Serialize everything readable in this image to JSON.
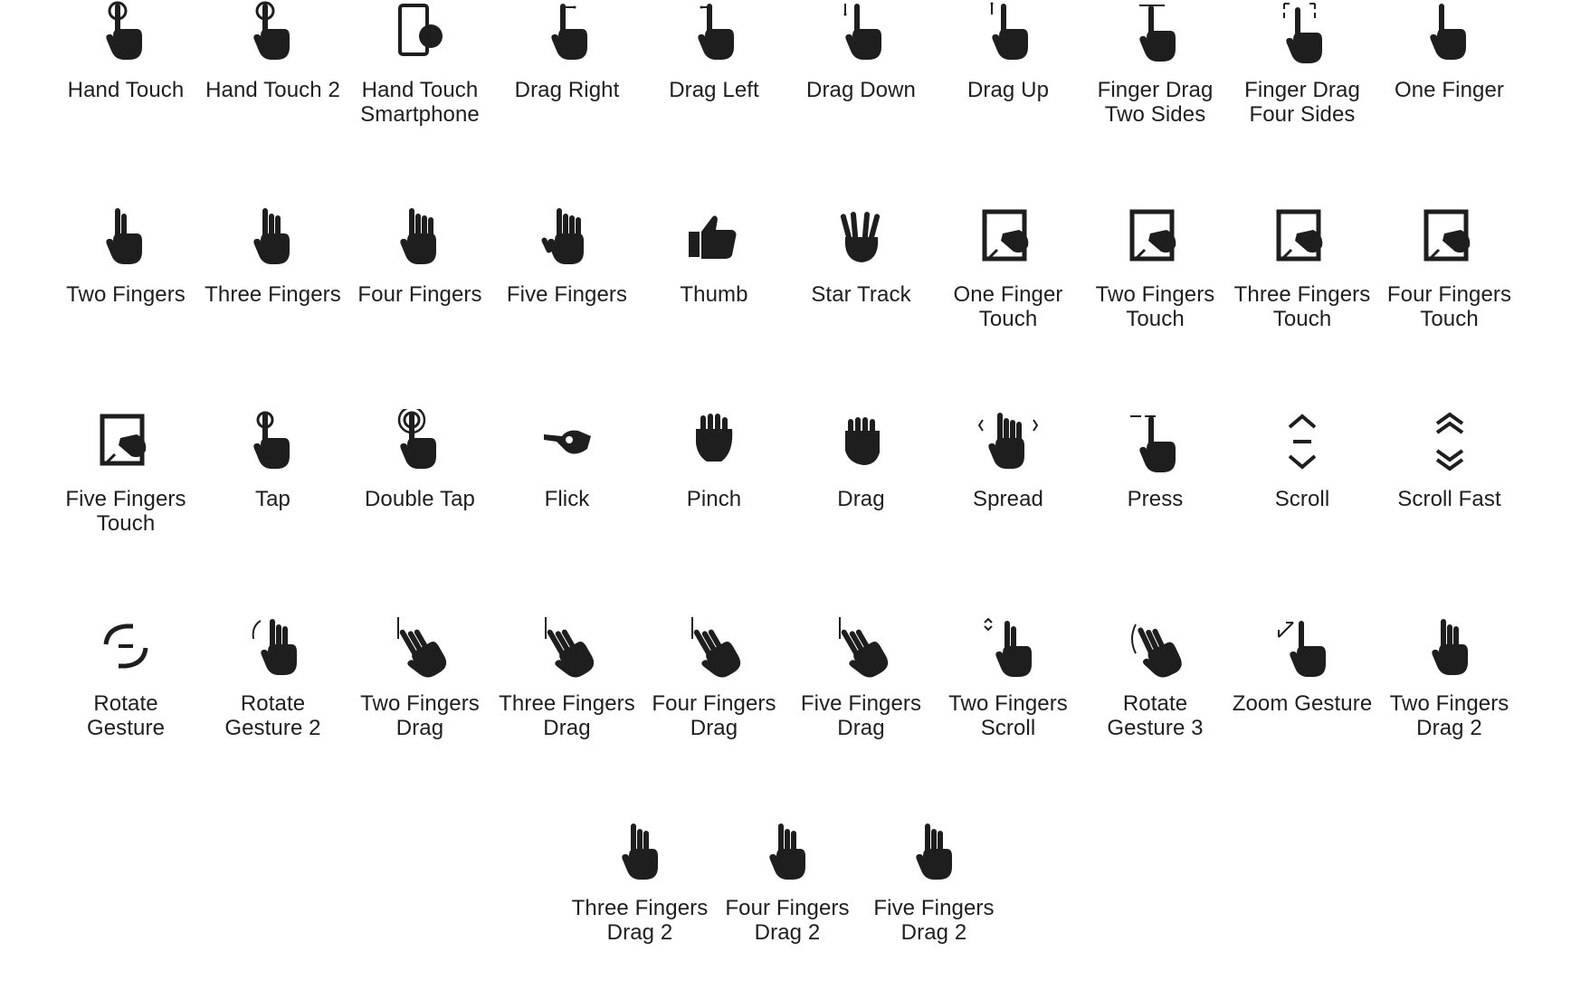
{
  "sheet": {
    "icon_color": "#1e1e1e",
    "background": "#ffffff"
  },
  "icons": [
    {
      "label": "Hand Touch",
      "icon": "hand-touch-icon"
    },
    {
      "label": "Hand Touch 2",
      "icon": "hand-touch-2-icon"
    },
    {
      "label": "Hand Touch Smartphone",
      "icon": "hand-touch-smartphone-icon"
    },
    {
      "label": "Drag Right",
      "icon": "drag-right-icon"
    },
    {
      "label": "Drag Left",
      "icon": "drag-left-icon"
    },
    {
      "label": "Drag Down",
      "icon": "drag-down-icon"
    },
    {
      "label": "Drag Up",
      "icon": "drag-up-icon"
    },
    {
      "label": "Finger Drag Two Sides",
      "icon": "finger-drag-two-sides-icon"
    },
    {
      "label": "Finger Drag Four Sides",
      "icon": "finger-drag-four-sides-icon"
    },
    {
      "label": "One Finger",
      "icon": "one-finger-icon"
    },
    {
      "label": "Two Fingers",
      "icon": "two-fingers-icon"
    },
    {
      "label": "Three Fingers",
      "icon": "three-fingers-icon"
    },
    {
      "label": "Four Fingers",
      "icon": "four-fingers-icon"
    },
    {
      "label": "Five Fingers",
      "icon": "five-fingers-icon"
    },
    {
      "label": "Thumb",
      "icon": "thumb-icon"
    },
    {
      "label": "Star Track",
      "icon": "star-track-icon"
    },
    {
      "label": "One Finger Touch",
      "icon": "one-finger-touch-icon"
    },
    {
      "label": "Two Fingers Touch",
      "icon": "two-fingers-touch-icon"
    },
    {
      "label": "Three Fingers Touch",
      "icon": "three-fingers-touch-icon"
    },
    {
      "label": "Four Fingers Touch",
      "icon": "four-fingers-touch-icon"
    },
    {
      "label": "Five Fingers Touch",
      "icon": "five-fingers-touch-icon"
    },
    {
      "label": "Tap",
      "icon": "tap-icon"
    },
    {
      "label": "Double Tap",
      "icon": "double-tap-icon"
    },
    {
      "label": "Flick",
      "icon": "flick-icon"
    },
    {
      "label": "Pinch",
      "icon": "pinch-icon"
    },
    {
      "label": "Drag",
      "icon": "drag-icon"
    },
    {
      "label": "Spread",
      "icon": "spread-icon"
    },
    {
      "label": "Press",
      "icon": "press-icon"
    },
    {
      "label": "Scroll",
      "icon": "scroll-icon"
    },
    {
      "label": "Scroll Fast",
      "icon": "scroll-fast-icon"
    },
    {
      "label": "Rotate Gesture",
      "icon": "rotate-gesture-icon"
    },
    {
      "label": "Rotate Gesture 2",
      "icon": "rotate-gesture-2-icon"
    },
    {
      "label": "Two Fingers Drag",
      "icon": "two-fingers-drag-icon"
    },
    {
      "label": "Three Fingers Drag",
      "icon": "three-fingers-drag-icon"
    },
    {
      "label": "Four Fingers Drag",
      "icon": "four-fingers-drag-icon"
    },
    {
      "label": "Five Fingers Drag",
      "icon": "five-fingers-drag-icon"
    },
    {
      "label": "Two Fingers Scroll",
      "icon": "two-fingers-scroll-icon"
    },
    {
      "label": "Rotate Gesture 3",
      "icon": "rotate-gesture-3-icon"
    },
    {
      "label": "Zoom Gesture",
      "icon": "zoom-gesture-icon"
    },
    {
      "label": "Two Fingers Drag 2",
      "icon": "two-fingers-drag-2-icon"
    },
    {
      "label": "Three Fingers Drag 2",
      "icon": "three-fingers-drag-2-icon"
    },
    {
      "label": "Four Fingers Drag 2",
      "icon": "four-fingers-drag-2-icon"
    },
    {
      "label": "Five Fingers Drag 2",
      "icon": "five-fingers-drag-2-icon"
    }
  ]
}
